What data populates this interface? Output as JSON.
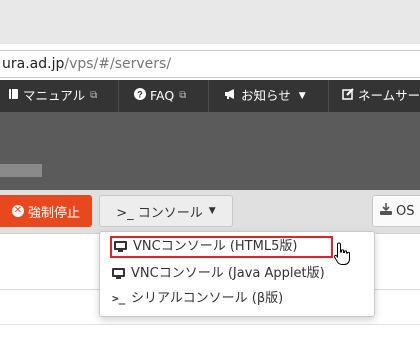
{
  "browser": {
    "url_domain": "ura.ad.jp",
    "url_path": "/vps/#/servers/"
  },
  "navbar": {
    "items": [
      {
        "icon": "book-icon",
        "label": "マニュアル"
      },
      {
        "icon": "question-icon",
        "label": "FAQ"
      },
      {
        "icon": "megaphone-icon",
        "label": "お知らせ"
      },
      {
        "icon": "edit-icon",
        "label": "ネームサー"
      }
    ]
  },
  "toolbar": {
    "stop_label": "強制停止",
    "console_label": ">_ コンソール",
    "os_label": "OS"
  },
  "console_menu": {
    "items": [
      {
        "icon": "monitor-icon",
        "label": "VNCコンソール (HTML5版)",
        "highlighted": true
      },
      {
        "icon": "monitor-icon",
        "label": "VNCコンソール (Java Applet版)"
      },
      {
        "icon": "terminal-icon",
        "label": "シリアルコンソール (β版)"
      }
    ]
  },
  "colors": {
    "stop_button": "#e8481e",
    "navbar": "#343434",
    "highlight_border": "#e0242b"
  }
}
